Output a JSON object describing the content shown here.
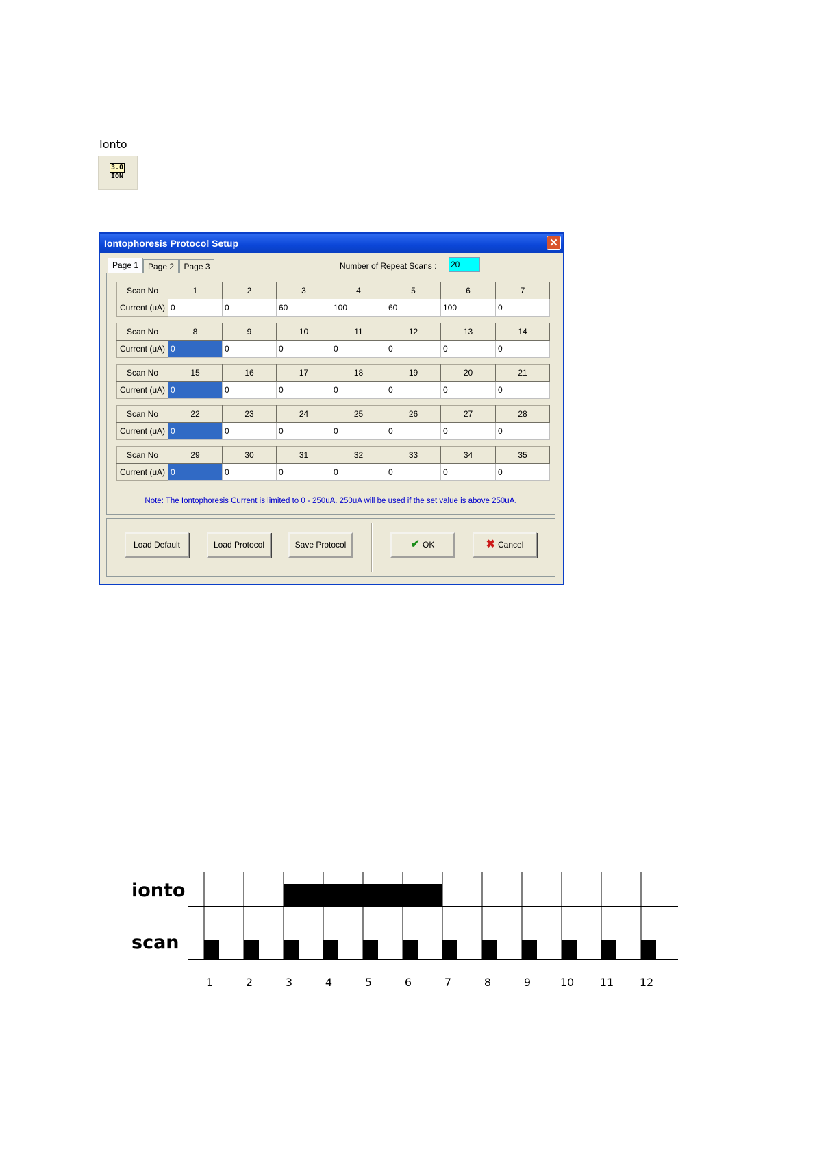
{
  "toolbar_icon": {
    "caption": "Ionto",
    "badge_top": "3.0",
    "badge_bottom": "ION"
  },
  "dialog": {
    "title": "Iontophoresis Protocol Setup",
    "close_glyph": "✕",
    "tabs": [
      "Page 1",
      "Page 2",
      "Page 3"
    ],
    "active_tab": "Page 1",
    "repeat_label": "Number of Repeat Scans :",
    "repeat_value": "20",
    "row_labels": {
      "scan": "Scan No",
      "current": "Current (uA)"
    },
    "blocks": [
      {
        "scans": [
          "1",
          "2",
          "3",
          "4",
          "5",
          "6",
          "7"
        ],
        "currents": [
          "0",
          "0",
          "60",
          "100",
          "60",
          "100",
          "0"
        ],
        "selected": -1
      },
      {
        "scans": [
          "8",
          "9",
          "10",
          "11",
          "12",
          "13",
          "14"
        ],
        "currents": [
          "0",
          "0",
          "0",
          "0",
          "0",
          "0",
          "0"
        ],
        "selected": 0
      },
      {
        "scans": [
          "15",
          "16",
          "17",
          "18",
          "19",
          "20",
          "21"
        ],
        "currents": [
          "0",
          "0",
          "0",
          "0",
          "0",
          "0",
          "0"
        ],
        "selected": 0
      },
      {
        "scans": [
          "22",
          "23",
          "24",
          "25",
          "26",
          "27",
          "28"
        ],
        "currents": [
          "0",
          "0",
          "0",
          "0",
          "0",
          "0",
          "0"
        ],
        "selected": 0
      },
      {
        "scans": [
          "29",
          "30",
          "31",
          "32",
          "33",
          "34",
          "35"
        ],
        "currents": [
          "0",
          "0",
          "0",
          "0",
          "0",
          "0",
          "0"
        ],
        "selected": 0
      }
    ],
    "note": "Note: The Iontophoresis Current is limited to 0 - 250uA. 250uA will be used if the set value is above 250uA.",
    "buttons": {
      "load_default": "Load Default",
      "load_protocol": "Load Protocol",
      "save_protocol": "Save Protocol",
      "ok": "OK",
      "cancel": "Cancel"
    },
    "colors": {
      "selected_cell": "#316ac5",
      "repeat_field": "#00ffff",
      "note_text": "#0000cc"
    }
  },
  "timing_diagram": {
    "labels": {
      "ionto": "ionto",
      "scan": "scan"
    },
    "scans": [
      "1",
      "2",
      "3",
      "4",
      "5",
      "6",
      "7",
      "8",
      "9",
      "10",
      "11",
      "12"
    ],
    "ionto_on_from_scan": 3,
    "ionto_on_to_scan": 7
  }
}
